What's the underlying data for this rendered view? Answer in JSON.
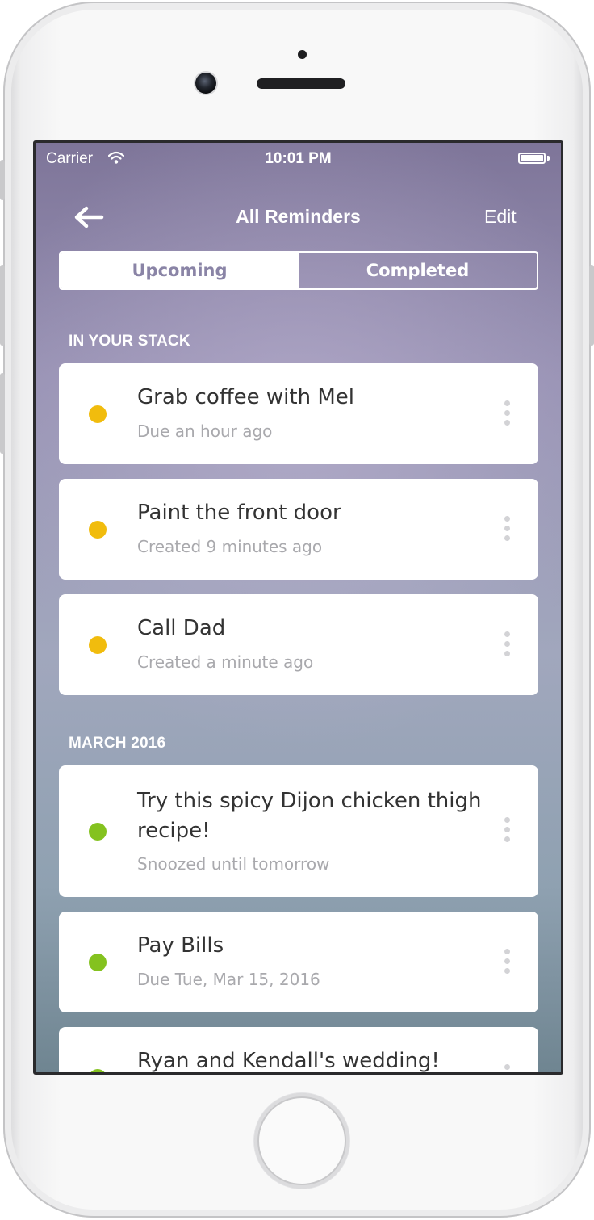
{
  "status_bar": {
    "carrier": "Carrier",
    "time": "10:01 PM",
    "wifi_icon": "wifi-icon",
    "battery_icon": "battery-icon"
  },
  "nav": {
    "back_icon": "arrow-left-icon",
    "title": "All Reminders",
    "edit_label": "Edit"
  },
  "segmented": {
    "upcoming_label": "Upcoming",
    "completed_label": "Completed",
    "selected": "Upcoming"
  },
  "sections": [
    {
      "header": "IN YOUR STACK",
      "items": [
        {
          "title": "Grab coffee with Mel",
          "subtitle": "Due an hour ago",
          "status_color": "#f1bc0d"
        },
        {
          "title": "Paint the front door",
          "subtitle": "Created 9 minutes ago",
          "status_color": "#f1bc0d"
        },
        {
          "title": "Call Dad",
          "subtitle": "Created a minute ago",
          "status_color": "#f1bc0d"
        }
      ]
    },
    {
      "header": "MARCH 2016",
      "items": [
        {
          "title": "Try this spicy Dijon chicken thigh recipe!",
          "subtitle": "Snoozed until tomorrow",
          "status_color": "#84c21f"
        },
        {
          "title": "Pay Bills",
          "subtitle": "Due Tue, Mar 15, 2016",
          "status_color": "#84c21f"
        },
        {
          "title": "Ryan and Kendall's wedding!",
          "subtitle": "",
          "status_color": "#84c21f"
        }
      ]
    }
  ],
  "colors": {
    "accent_yellow": "#f1bc0d",
    "accent_green": "#84c21f",
    "background_top": "#7e7599",
    "background_bottom": "#6f8591"
  }
}
